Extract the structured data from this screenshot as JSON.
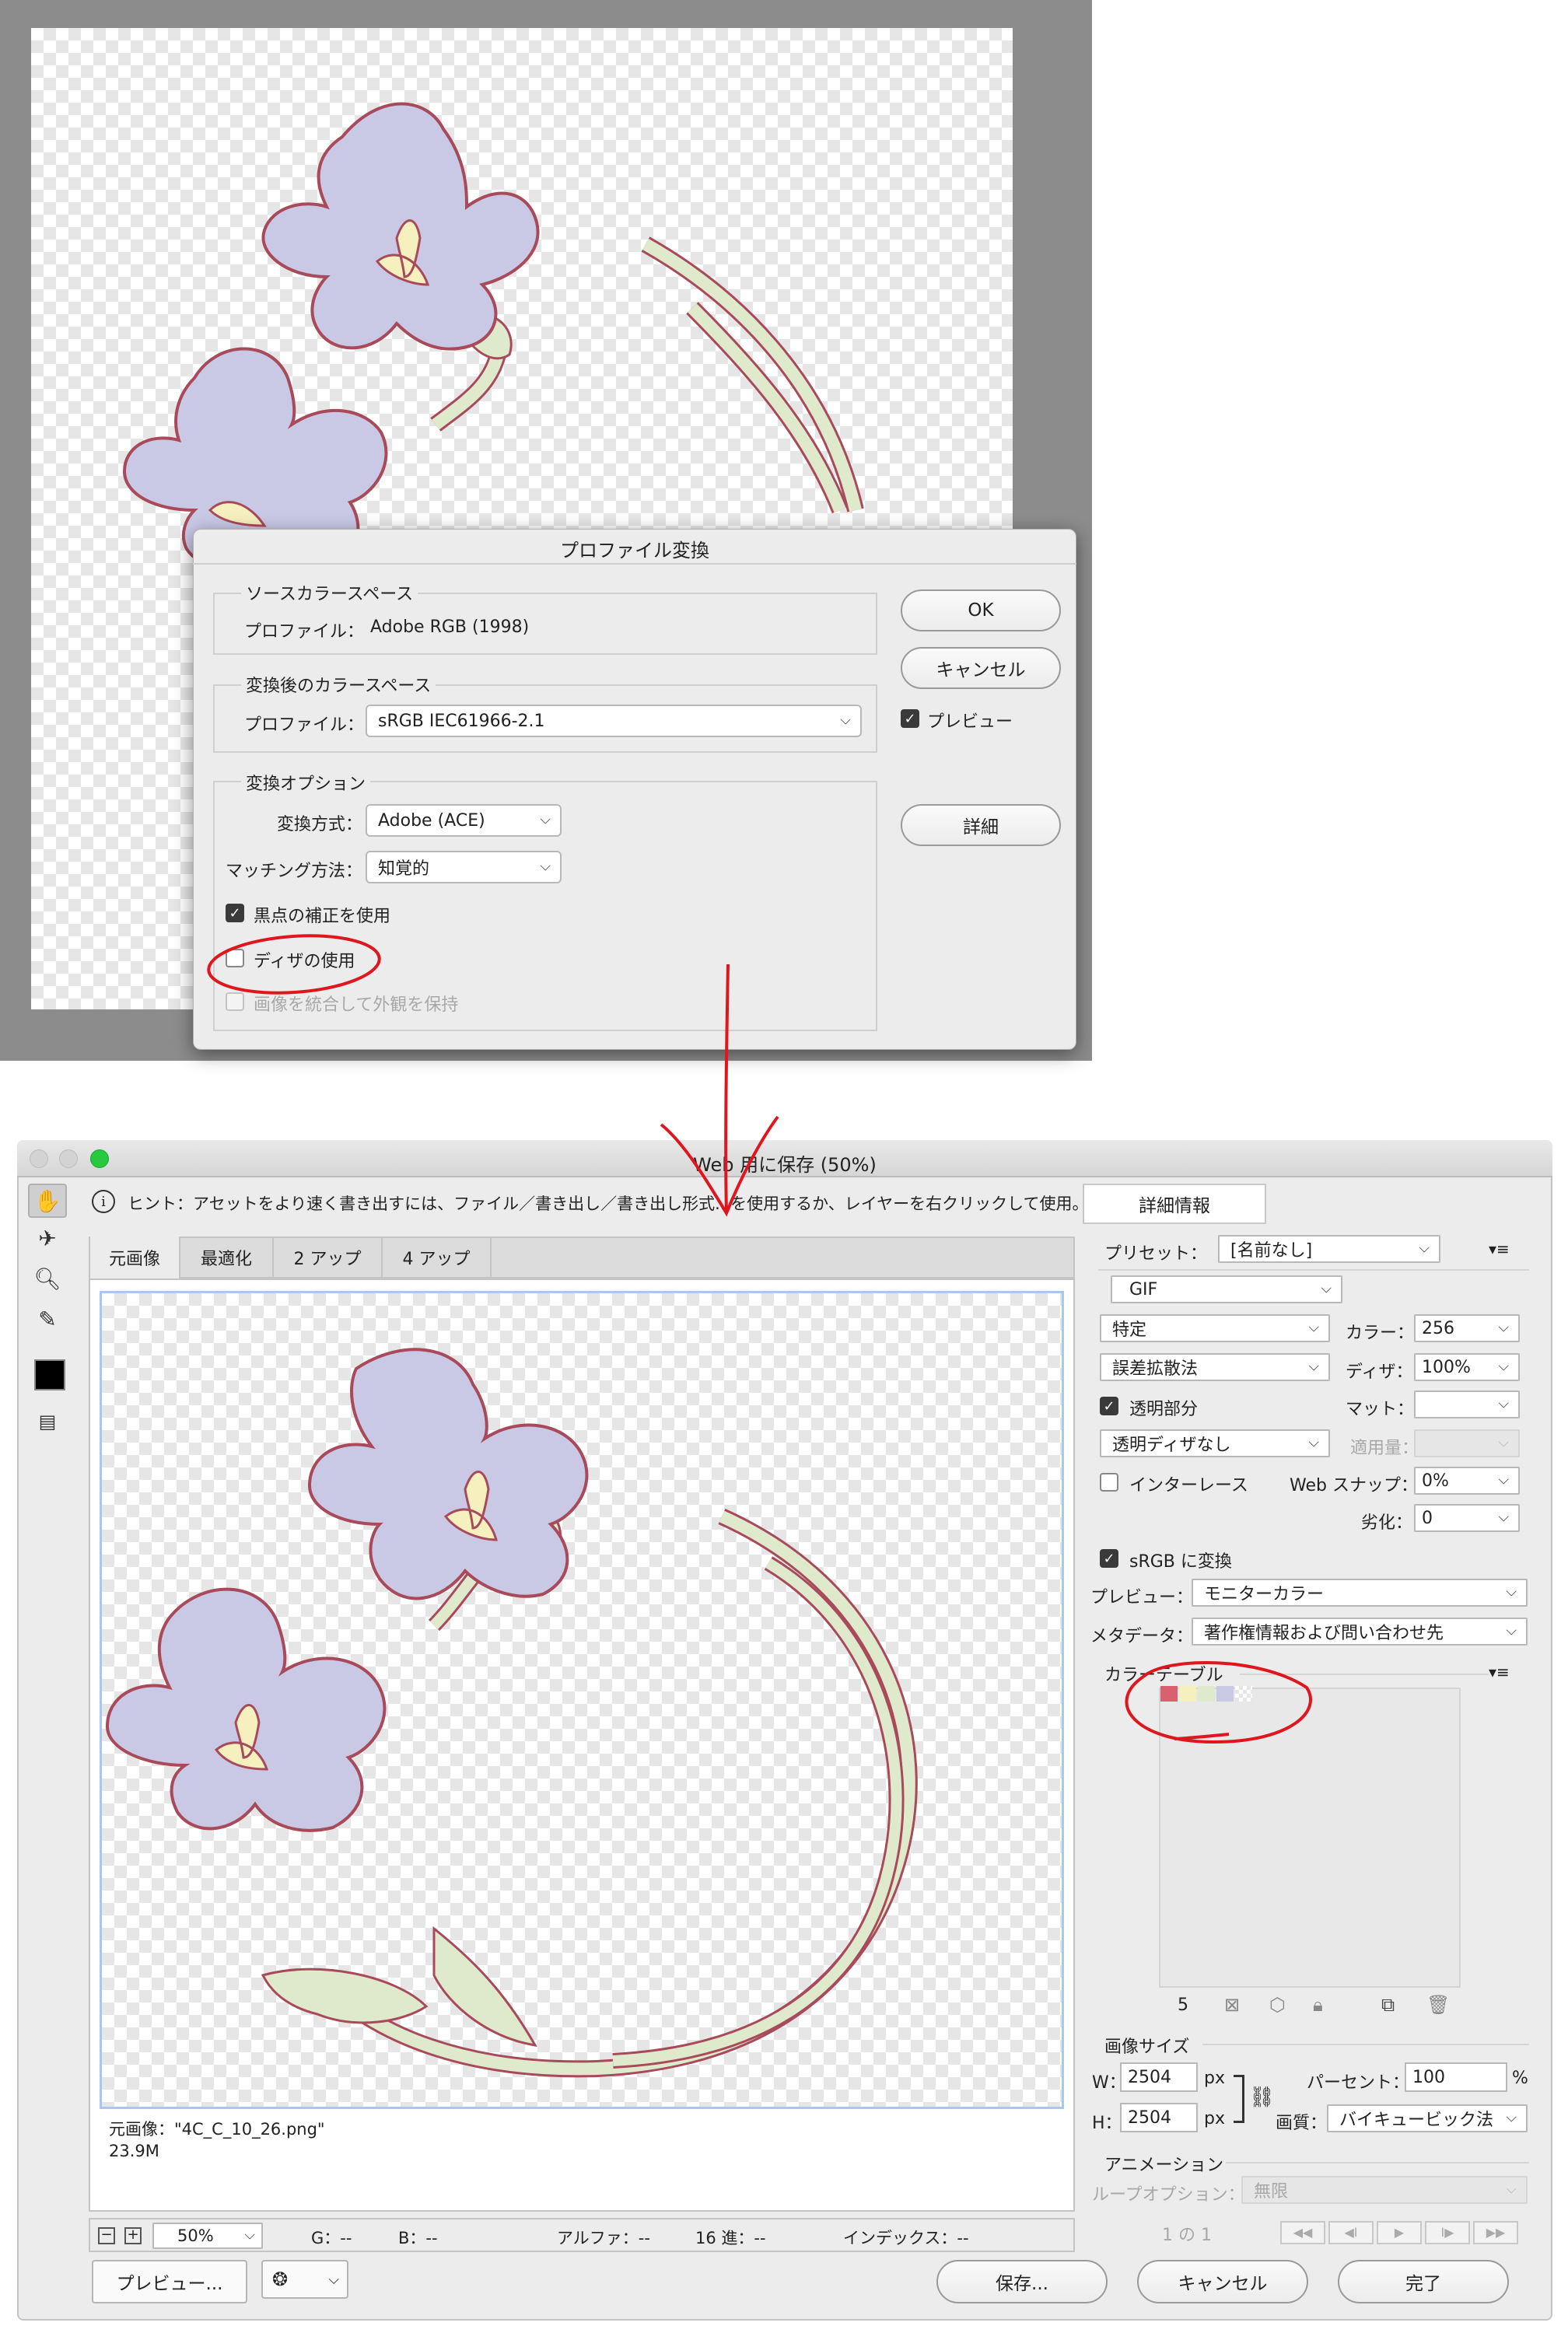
{
  "top_dialog": {
    "title": "プロファイル変換",
    "source_group": "ソースカラースペース",
    "source_profile_label": "プロファイル：",
    "source_profile_value": "Adobe RGB (1998)",
    "dest_group": "変換後のカラースペース",
    "dest_profile_label": "プロファイル：",
    "dest_profile_value": "sRGB IEC61966-2.1",
    "options_group": "変換オプション",
    "engine_label": "変換方式：",
    "engine_value": "Adobe (ACE)",
    "intent_label": "マッチング方法：",
    "intent_value": "知覚的",
    "bpc_label": "黒点の補正を使用",
    "dither_label": "ディザの使用",
    "flatten_label": "画像を統合して外観を保持",
    "ok": "OK",
    "cancel": "キャンセル",
    "preview": "プレビュー",
    "advanced": "詳細"
  },
  "sfw": {
    "title": "Web 用に保存 (50%)",
    "hint": "ヒント：アセットをより速く書き出すには、ファイル／書き出し／書き出し形式...を使用するか、レイヤーを右クリックして使用。",
    "details_button": "詳細情報",
    "tabs": [
      "元画像",
      "最適化",
      "2 アップ",
      "4 アップ"
    ],
    "image_info_name": "元画像：\"4C_C_10_26.png\"",
    "image_info_size": "23.9M",
    "zoom": "50%",
    "status": {
      "g": "G：--",
      "b": "B：--",
      "alpha": "アルファ：--",
      "hex": "16 進：--",
      "index": "インデックス：--"
    },
    "preset_label": "プリセット：",
    "preset_value": "[名前なし]",
    "format": "GIF",
    "reduction": "特定",
    "colors_label": "カラー：",
    "colors_value": "256",
    "dither_algo": "誤差拡散法",
    "dither_label": "ディザ：",
    "dither_value": "100%",
    "transparency_label": "透明部分",
    "matte_label": "マット：",
    "trans_dither": "透明ディザなし",
    "amount_label": "適用量：",
    "interlace_label": "インターレース",
    "websnap_label": "Web スナップ：",
    "websnap_value": "0%",
    "lossy_label": "劣化：",
    "lossy_value": "0",
    "srgb_label": "sRGB に変換",
    "preview_label": "プレビュー：",
    "preview_value": "モニターカラー",
    "metadata_label": "メタデータ：",
    "metadata_value": "著作権情報および問い合わせ先",
    "color_table_label": "カラーテーブル",
    "color_count": "5",
    "swatch_colors": [
      "#d9606e",
      "#f6efbe",
      "#dfeacc",
      "#c9c9e6"
    ],
    "image_size_label": "画像サイズ",
    "w_label": "W：",
    "w_value": "2504",
    "h_label": "H：",
    "h_value": "2504",
    "px": "px",
    "percent_label": "パーセント：",
    "percent_value": "100",
    "percent_unit": "%",
    "quality_label": "画質：",
    "quality_value": "バイキュービック法",
    "animation_label": "アニメーション",
    "loop_label": "ループオプション：",
    "loop_value": "無限",
    "frame_counter": "1 の 1",
    "preview_button": "プレビュー...",
    "save_button": "保存...",
    "cancel_button": "キャンセル",
    "done_button": "完了"
  },
  "colors": {
    "annotation": "#e0161e",
    "flower_fill": "#c9c9e6",
    "flower_stroke": "#a84a5a",
    "stem_fill": "#dfeacc",
    "stamen": "#f6efbe",
    "selection_blue": "#a9c8ef"
  }
}
